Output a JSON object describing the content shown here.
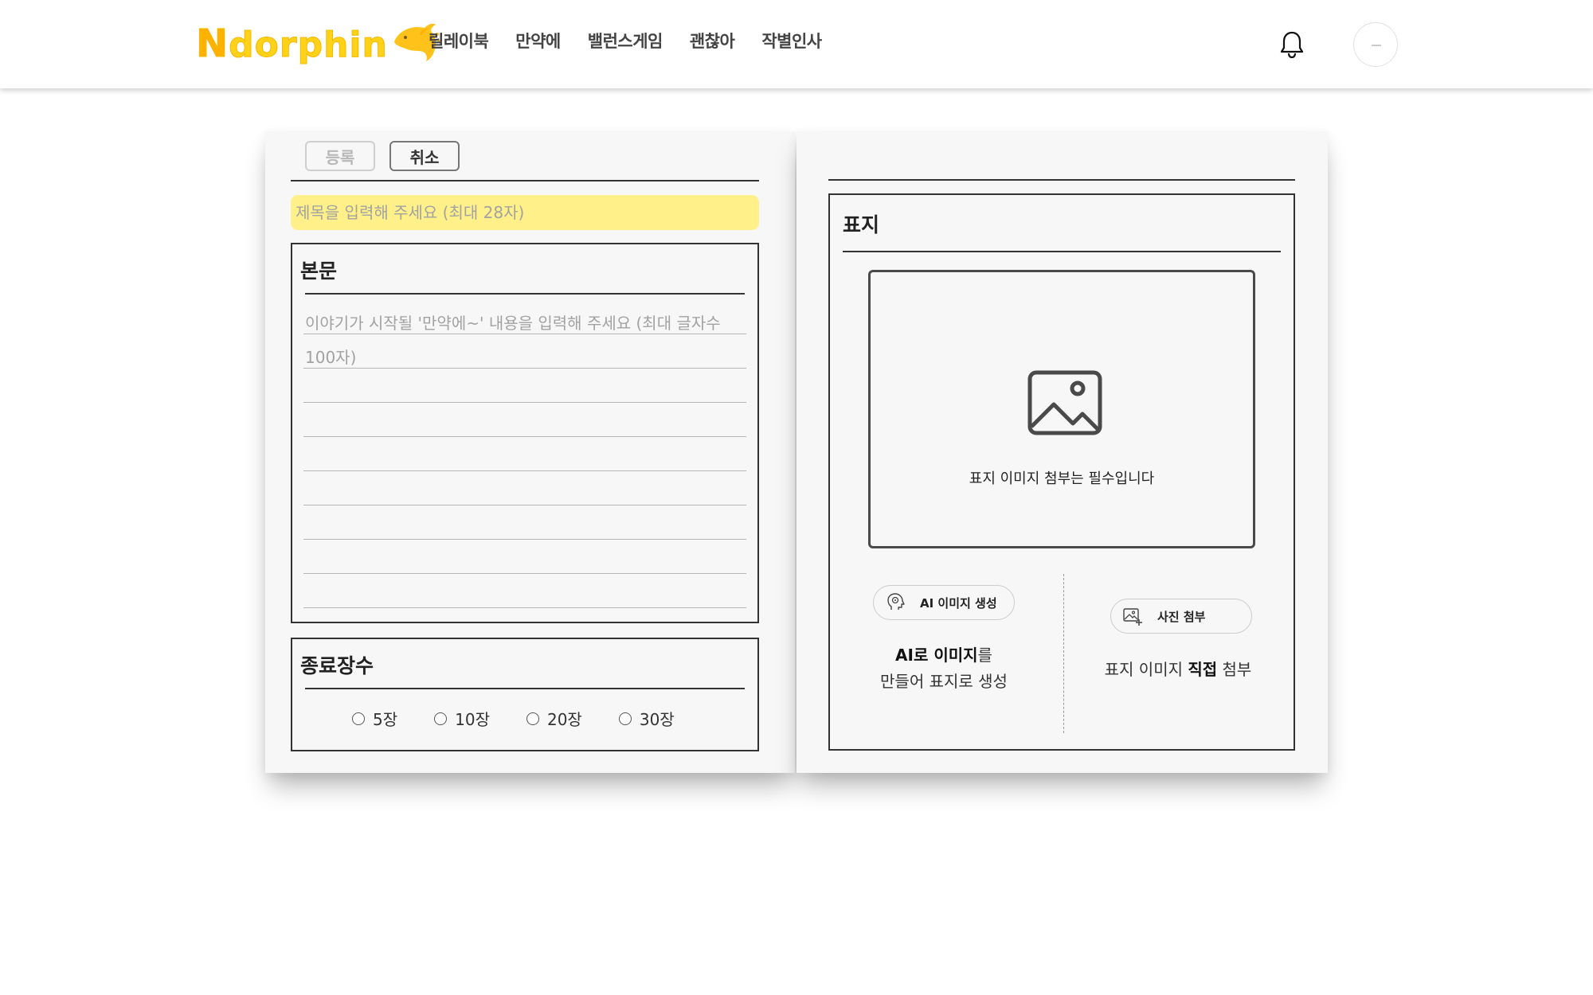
{
  "header": {
    "logo_first": "N",
    "logo_rest": "dorphin",
    "nav": [
      "릴레이북",
      "만약에",
      "밸런스게임",
      "괜찮아",
      "작별인사"
    ],
    "bell_icon": "bell-icon",
    "avatar_icon": "avatar"
  },
  "left_page": {
    "submit_label": "등록",
    "cancel_label": "취소",
    "title_placeholder": "제목을 입력해 주세요 (최대 28자)",
    "body": {
      "title": "본문",
      "placeholder": "이야기가 시작될 '만약에~' 내용을 입력해 주세요 (최대 글자수 100자)"
    },
    "end_pages": {
      "title": "종료장수",
      "options": [
        "5장",
        "10장",
        "20장",
        "30장"
      ]
    }
  },
  "right_page": {
    "cover": {
      "title": "표지",
      "image_note": "표지 이미지 첨부는 필수입니다",
      "ai_button_label": "AI 이미지 생성",
      "ai_desc_bold": "AI로 이미지",
      "ai_desc_rest": "를",
      "ai_desc_line2": "만들어 표지로 생성",
      "upload_button_label": "사진 첨부",
      "upload_desc_pre": "표지 이미지 ",
      "upload_desc_bold": "직접",
      "upload_desc_post": " 첨부"
    }
  },
  "colors": {
    "logo_yellow": "#ffd21a",
    "title_input_bg": "#fff08a",
    "page_bg": "#f7f7f7"
  }
}
